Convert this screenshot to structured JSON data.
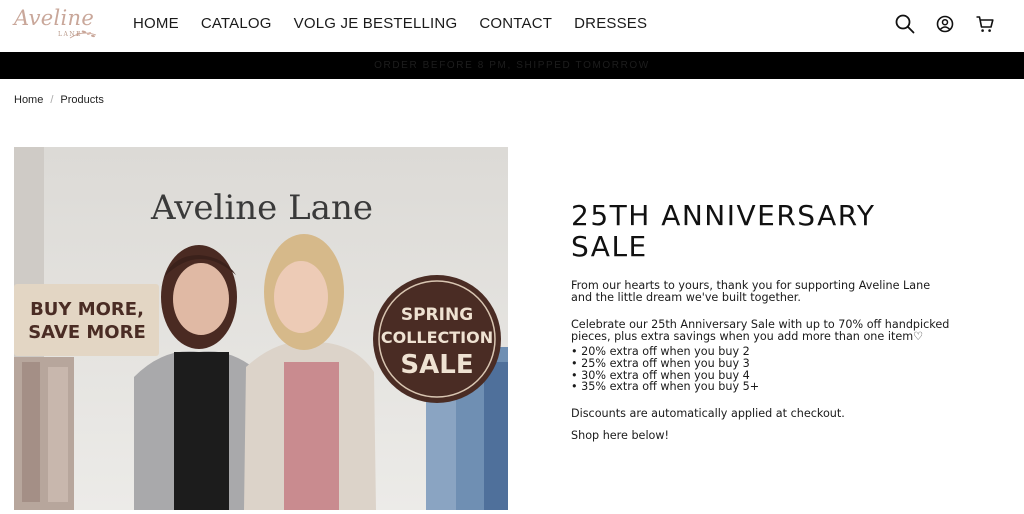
{
  "header": {
    "logo": {
      "script": "Aveline",
      "sub": "LANE"
    },
    "nav": [
      "HOME",
      "CATALOG",
      "VOLG JE BESTELLING",
      "CONTACT",
      "DRESSES"
    ],
    "icons": [
      "search-icon",
      "account-icon",
      "cart-icon"
    ]
  },
  "announcement": {
    "text": "ORDER BEFORE 8 PM, SHIPPED TOMORROW"
  },
  "breadcrumb": [
    "Home",
    "Products"
  ],
  "hero": {
    "wall_text": "Aveline Lane",
    "left_sign": [
      "BUY MORE,",
      "SAVE MORE"
    ],
    "right_sign": [
      "SPRING",
      "COLLECTION",
      "SALE"
    ]
  },
  "content": {
    "title_line1": "25TH ANNIVERSARY",
    "title_line2": "SALE",
    "p1_line1": "From our hearts to yours, thank you for supporting Aveline Lane",
    "p1_line2": "and the little dream we've built together.",
    "p2_line1": "Celebrate our 25th Anniversary Sale with up to 70% off handpicked",
    "p2_line2": "pieces, plus extra savings when you add more than one item♡",
    "discounts": [
      "20% extra off when you buy 2",
      "25% extra off when you buy 3",
      "30% extra off when you buy 4",
      "35% extra off when you buy 5+"
    ],
    "p3": "Discounts are automatically applied at checkout.",
    "p4": "Shop here below!"
  },
  "colors": {
    "announce_bg": "#000000",
    "logo": "#c9a79a",
    "sign_dark": "#4a2c24"
  }
}
